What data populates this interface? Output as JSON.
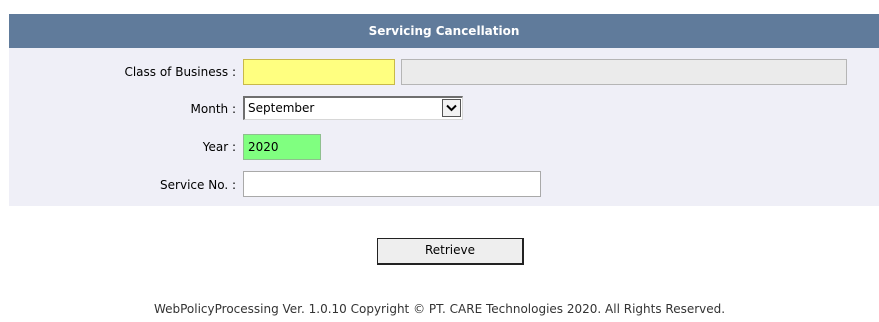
{
  "form": {
    "title": "Servicing Cancellation",
    "class_of_business": {
      "label": "Class of Business :",
      "code_value": "",
      "description_value": ""
    },
    "month": {
      "label": "Month :",
      "selected": "September"
    },
    "year": {
      "label": "Year :",
      "value": "2020"
    },
    "service_no": {
      "label": "Service No. :",
      "value": ""
    }
  },
  "actions": {
    "retrieve_label": "Retrieve"
  },
  "footer": {
    "text": "WebPolicyProcessing Ver. 1.0.10 Copyright © PT. CARE Technologies 2020. All Rights Reserved."
  },
  "icons": {
    "dropdown": "chevron-down-icon"
  },
  "colors": {
    "header_bg": "#607b9b",
    "panel_bg": "#efeff7",
    "mandatory_field": "#ffff80",
    "key_field": "#80ff80"
  }
}
